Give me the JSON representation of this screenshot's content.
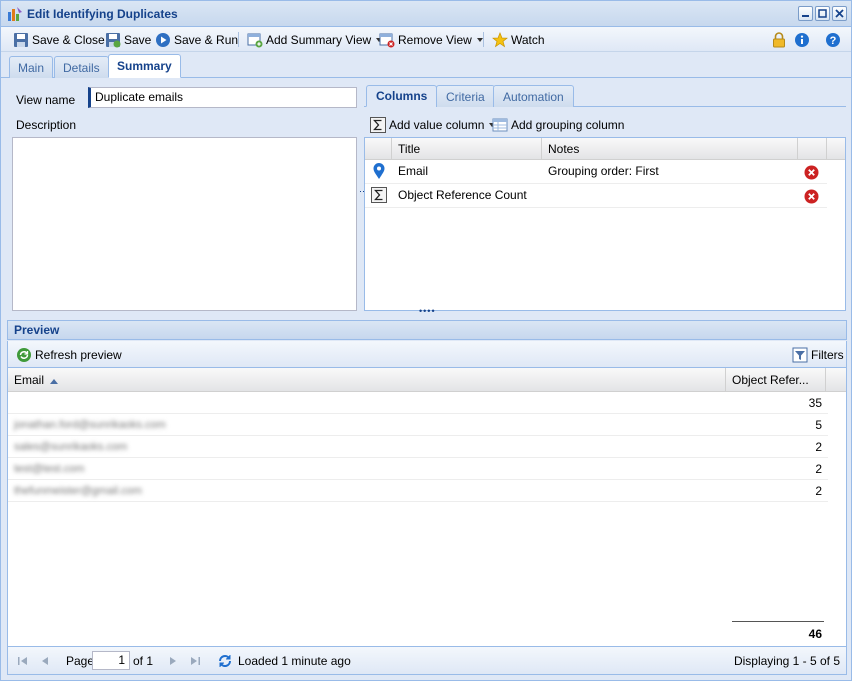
{
  "window": {
    "title": "Edit Identifying Duplicates"
  },
  "toolbar": {
    "save_close": "Save & Close",
    "save": "Save",
    "save_run": "Save & Run",
    "add_summary_view": "Add Summary View",
    "remove_view": "Remove View",
    "watch": "Watch"
  },
  "tabs": [
    "Main",
    "Details",
    "Summary"
  ],
  "summary": {
    "view_name_label": "View name",
    "view_name_value": "Duplicate emails",
    "description_label": "Description",
    "subtabs": [
      "Columns",
      "Criteria",
      "Automation"
    ],
    "add_value_column": "Add value column",
    "add_grouping_column": "Add grouping column",
    "columns_header": {
      "title": "Title",
      "notes": "Notes"
    },
    "columns": [
      {
        "icon": "map-pin-icon",
        "title": "Email",
        "notes": "Grouping order: First"
      },
      {
        "icon": "sigma-icon",
        "title": "Object Reference Count",
        "notes": ""
      }
    ]
  },
  "preview": {
    "header": "Preview",
    "refresh": "Refresh preview",
    "filters": "Filters",
    "col_email": "Email",
    "col_count": "Object Refer...",
    "rows": [
      {
        "email": "",
        "count": "35"
      },
      {
        "email": "jonathan.ford@sunrikaoks.com",
        "count": "5"
      },
      {
        "email": "sales@sunrikaoks.com",
        "count": "2"
      },
      {
        "email": "test@test.com",
        "count": "2"
      },
      {
        "email": "thefunmeister@gmail.com",
        "count": "2"
      }
    ],
    "total": "46"
  },
  "pager": {
    "page_label": "Page",
    "page_value": "1",
    "of_label": "of 1",
    "loaded": "Loaded 1 minute ago",
    "displaying": "Displaying 1 - 5 of 5"
  },
  "colors": {
    "accent": "#15428b",
    "border": "#99bbe8",
    "panel": "#dfe8f6",
    "delete": "#cc2222"
  }
}
